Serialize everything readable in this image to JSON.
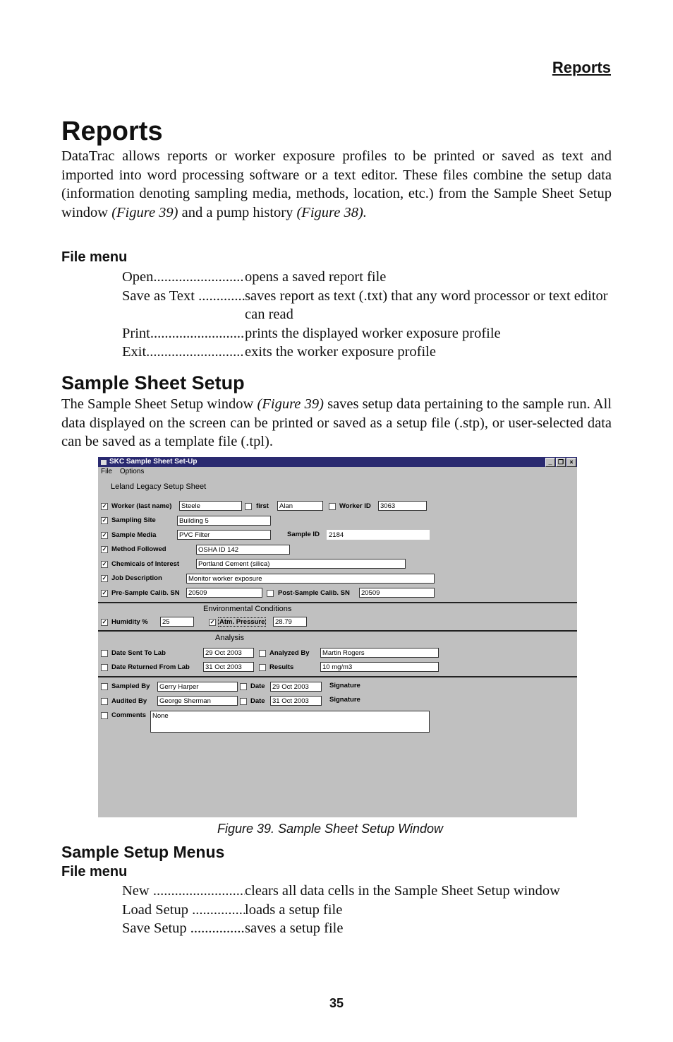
{
  "page_header": "Reports",
  "title": "Reports",
  "intro": {
    "text1": "DataTrac allows reports or worker exposure profiles to be printed or saved as text and imported into word processing software or a text editor. These files combine the setup data (information denoting sampling media, methods, location, etc.) from the Sample Sheet Setup window ",
    "ref1": "(Figure 39)",
    "text2": " and a pump history ",
    "ref2": "(Figure 38)."
  },
  "file_menu_1": {
    "heading": "File menu",
    "items": [
      {
        "term": "Open",
        "desc": "opens a saved report file"
      },
      {
        "term": "Save as Text ",
        "desc": "saves report as text (.txt) that any word processor or text editor can read"
      },
      {
        "term": "Print",
        "desc": "prints the displayed worker exposure profile"
      },
      {
        "term": "Exit",
        "desc": "exits the worker exposure profile"
      }
    ]
  },
  "sample_sheet": {
    "heading": "Sample Sheet Setup",
    "text1": "The Sample Sheet Setup window ",
    "ref": "(Figure 39)",
    "text2": " saves setup data pertaining to the sample run. All data displayed on the screen can be printed or saved as a setup file (.stp), or user-selected data can be saved as a template file (.tpl)."
  },
  "window": {
    "title": "SKC Sample Sheet Set-Up",
    "menu": [
      "File",
      "Options"
    ],
    "sheet_title": "Leland Legacy Setup Sheet",
    "fields": {
      "worker_last_label": "Worker (last name)",
      "worker_last": "Steele",
      "first_label": "first",
      "first": "Alan",
      "worker_id_label": "Worker ID",
      "worker_id": "3063",
      "sampling_site_label": "Sampling Site",
      "sampling_site": "Building 5",
      "sample_media_label": "Sample Media",
      "sample_media": "PVC Filter",
      "sample_id_label": "Sample ID",
      "sample_id": "2184",
      "method_label": "Method Followed",
      "method": "OSHA ID 142",
      "chemicals_label": "Chemicals of Interest",
      "chemicals": "Portland Cement (silica)",
      "job_label": "Job Description",
      "job": "Monitor worker exposure",
      "pre_calib_label": "Pre-Sample Calib. SN",
      "pre_calib": "20509",
      "post_calib_label": "Post-Sample Calib. SN",
      "post_calib": "20509",
      "env_heading": "Environmental Conditions",
      "humidity_label": "Humidity %",
      "humidity": "25",
      "pressure_label": "Atm. Pressure",
      "pressure": "28.79",
      "analysis_heading": "Analysis",
      "date_sent_label": "Date Sent To Lab",
      "date_sent": "29 Oct 2003",
      "analyzed_by_label": "Analyzed By",
      "analyzed_by": "Martin Rogers",
      "date_returned_label": "Date Returned From Lab",
      "date_returned": "31 Oct 2003",
      "results_label": "Results",
      "results": "10 mg/m3",
      "sampled_by_label": "Sampled By",
      "sampled_by": "Gerry Harper",
      "date1_label": "Date",
      "date1": "29 Oct 2003",
      "signature1": "Signature",
      "audited_by_label": "Audited By",
      "audited_by": "George Sherman",
      "date2_label": "Date",
      "date2": "31 Oct 2003",
      "signature2": "Signature",
      "comments_label": "Comments",
      "comments": "None"
    },
    "check": "✓"
  },
  "caption": "Figure 39. Sample Sheet Setup Window",
  "setup_menus": {
    "heading": "Sample Setup Menus",
    "subheading": "File menu",
    "items": [
      {
        "term": "New ",
        "desc": "clears all data cells in the Sample Sheet Setup window"
      },
      {
        "term": "Load Setup ",
        "desc": "loads a setup file"
      },
      {
        "term": "Save Setup ",
        "desc": "saves a setup file"
      }
    ]
  },
  "page_number": "35"
}
